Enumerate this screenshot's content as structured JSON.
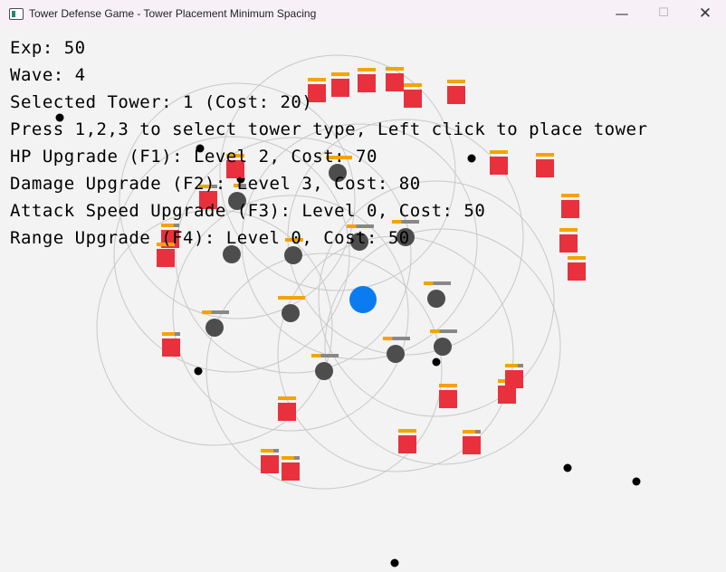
{
  "window": {
    "title": "Tower Defense Game - Tower Placement Minimum Spacing",
    "minimize_icon": "minimize-icon",
    "maximize_icon": "maximize-icon",
    "close_icon": "close-icon"
  },
  "hud": {
    "exp": "Exp: 50",
    "wave": "Wave: 4",
    "selected_tower": "Selected Tower: 1 (Cost: 20)",
    "instructions": "Press 1,2,3 to select tower type, Left click to place tower",
    "hp_upgrade": "HP Upgrade (F1): Level 2, Cost: 70",
    "damage_upgrade": "Damage Upgrade (F2): Level 3, Cost: 80",
    "attack_speed_upgrade": "Attack Speed Upgrade (F3): Level 0, Cost: 50",
    "range_upgrade": "Range Upgrade (F4): Level 0, Cost: 50"
  },
  "colors": {
    "background": "#f3f3f3",
    "tower": "#4d4d4d",
    "base": "#0a7cf0",
    "enemy": "#e8313d",
    "health_bar": "#f5a300",
    "health_bar_missing": "#888888",
    "range_ring": "#c8c8c8",
    "projectile": "#000000"
  }
}
